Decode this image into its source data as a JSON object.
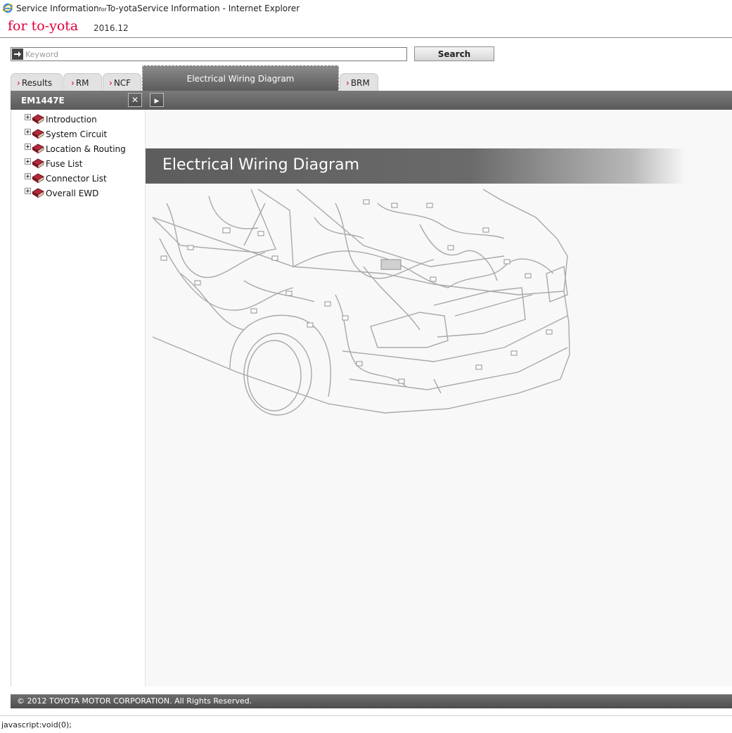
{
  "window": {
    "title_part1": "Service Information",
    "title_small": "for",
    "title_part2": "To-yotaService Information - Internet Explorer"
  },
  "header": {
    "brand": "for to-yota",
    "version": "2016.12"
  },
  "search": {
    "placeholder": "Keyword",
    "value": "",
    "button_label": "Search"
  },
  "tabs": [
    {
      "label": "Results",
      "active": false
    },
    {
      "label": "RM",
      "active": false
    },
    {
      "label": "NCF",
      "active": false
    },
    {
      "label": "Electrical Wiring Diagram",
      "active": true
    },
    {
      "label": "BRM",
      "active": false
    }
  ],
  "toolbar": {
    "doc_code": "EM1447E",
    "close_symbol": "✕",
    "next_symbol": "▶"
  },
  "sidebar": {
    "items": [
      {
        "label": "Introduction"
      },
      {
        "label": "System Circuit"
      },
      {
        "label": "Location & Routing"
      },
      {
        "label": "Fuse List"
      },
      {
        "label": "Connector List"
      },
      {
        "label": "Overall EWD"
      }
    ]
  },
  "main": {
    "banner_title": "Electrical Wiring Diagram"
  },
  "footer": {
    "copyright": "© 2012 TOYOTA MOTOR CORPORATION. All Rights Reserved."
  },
  "status": {
    "text": "javascript:void(0);"
  },
  "colors": {
    "brand_red": "#e0003a",
    "chevron_red": "#d10026",
    "bar_gray": "#5a5a5a"
  }
}
